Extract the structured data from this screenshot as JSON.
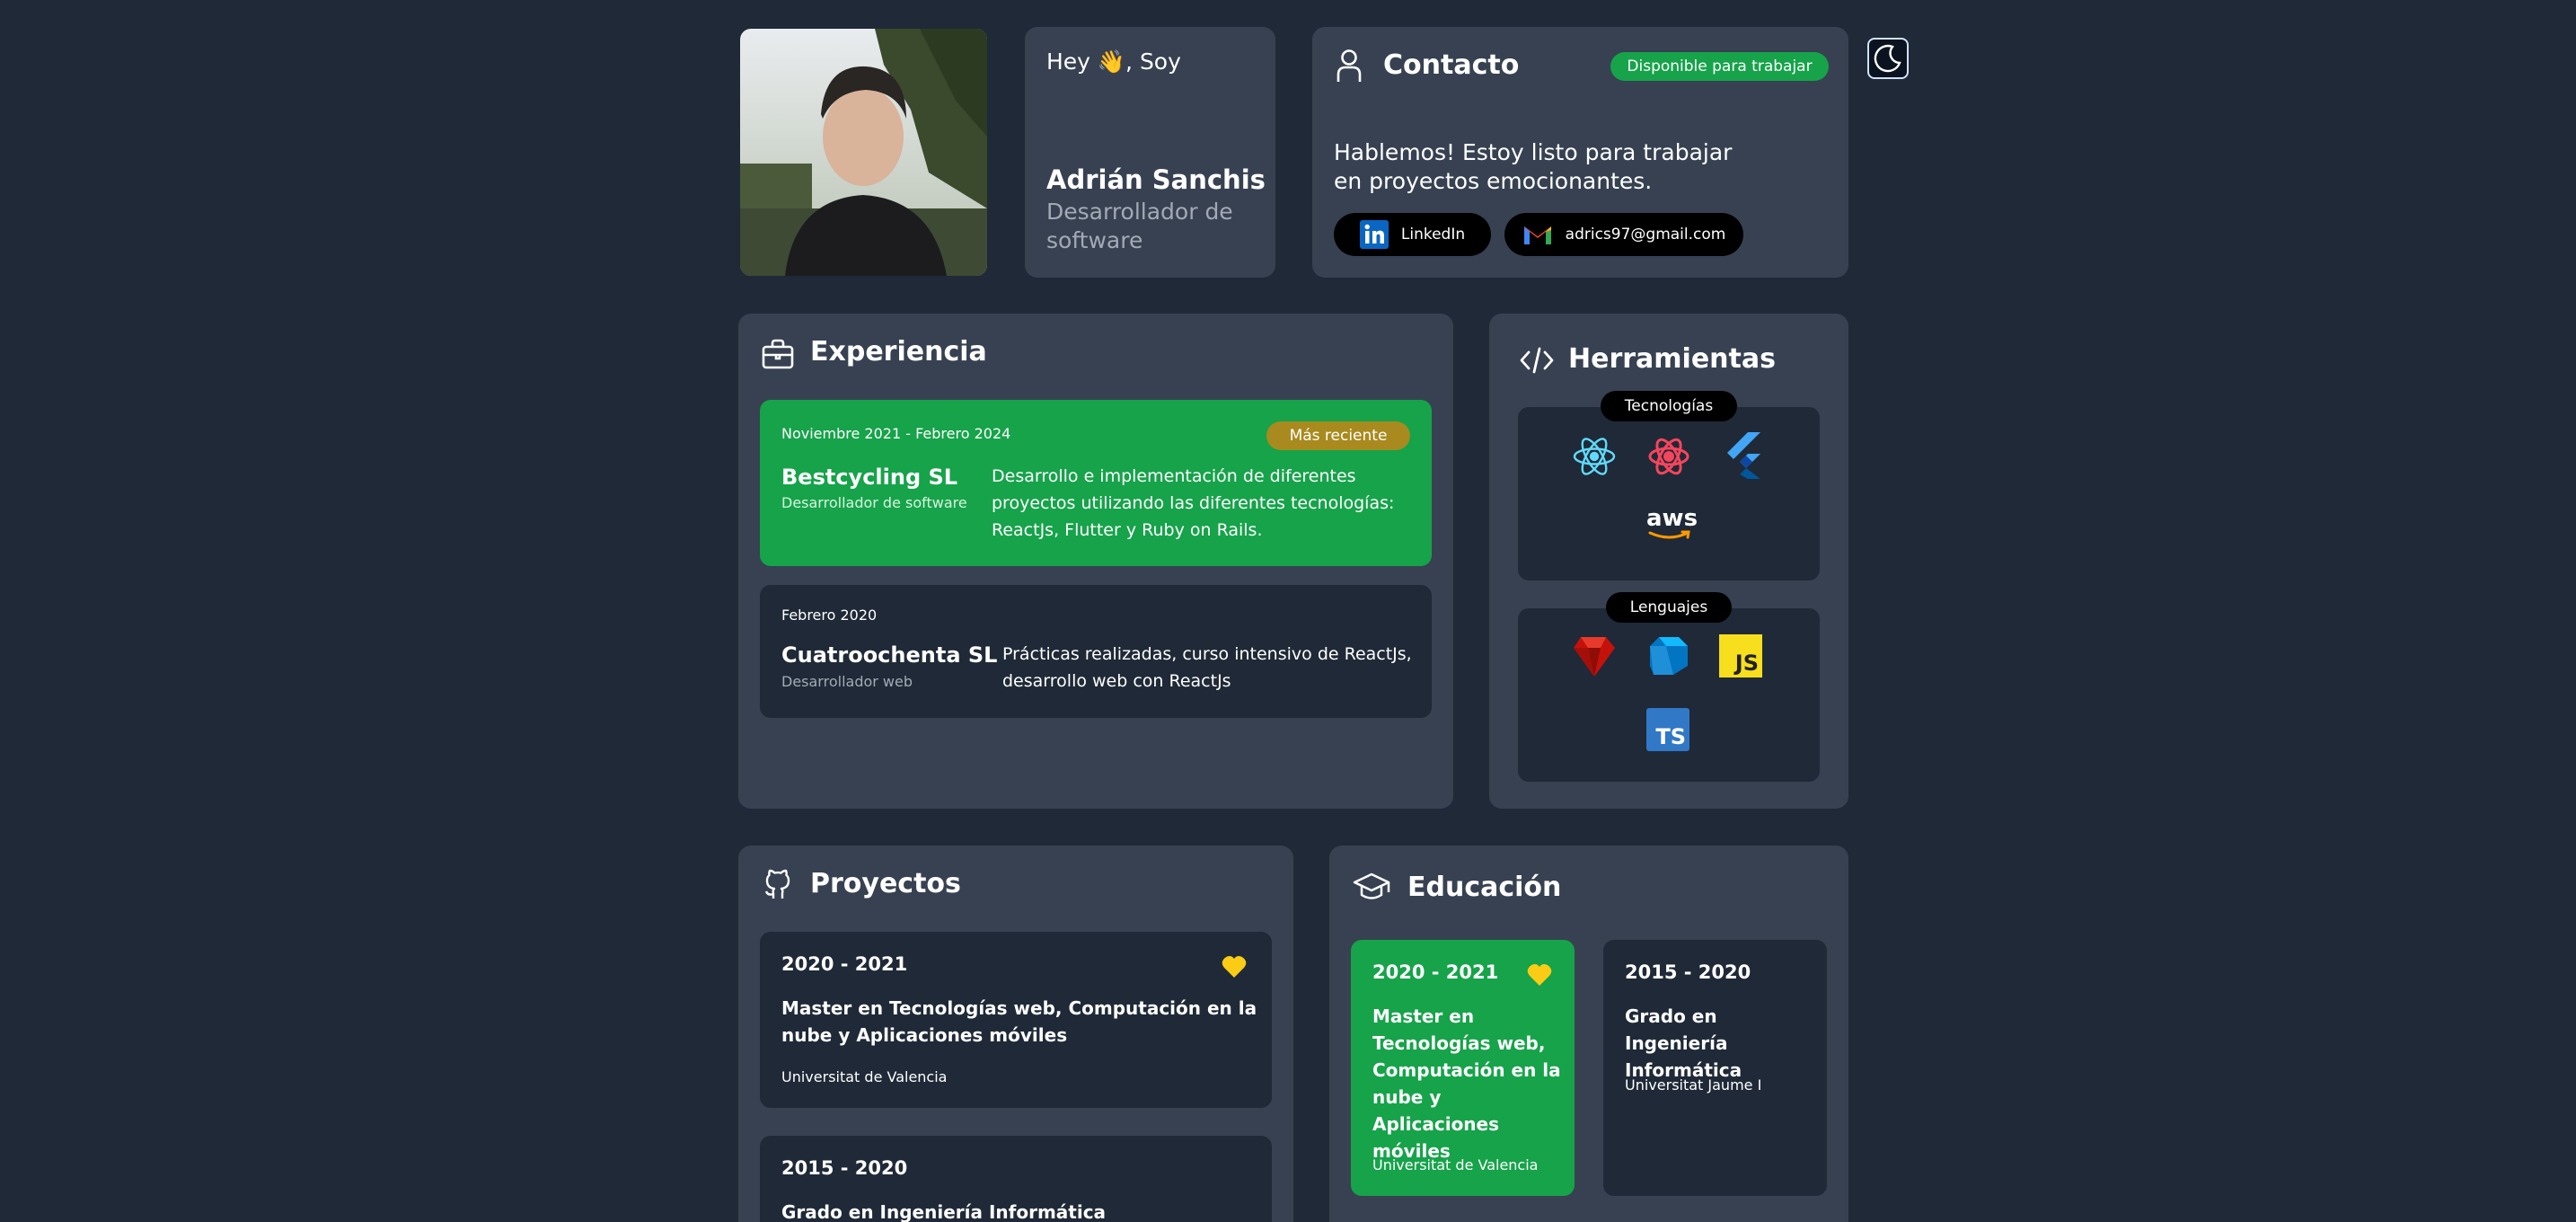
{
  "profile": {
    "photo_alt": "Foto de perfil",
    "greeting": "Hey 👋, Soy",
    "name": "Adrián Sanchis",
    "role": "Desarrollador de software"
  },
  "contact": {
    "title": "Contacto",
    "badge": "Disponible para trabajar",
    "message": "Hablemos! Estoy listo para trabajar en proyectos emocionantes.",
    "linkedin_label": "LinkedIn",
    "email_label": "adrics97@gmail.com"
  },
  "experience": {
    "title": "Experiencia",
    "items": [
      {
        "dates": "Noviembre 2021 - Febrero 2024",
        "badge": "Más reciente",
        "company": "Bestcycling SL",
        "role": "Desarrollador de software",
        "description": "Desarrollo e implementación de diferentes proyectos utilizando las diferentes tecnologías: ReactJs, Flutter y Ruby on Rails."
      },
      {
        "dates": "Febrero 2020",
        "company": "Cuatroochenta SL",
        "role": "Desarrollador web",
        "description": "Prácticas realizadas, curso intensivo de ReactJs, desarrollo web con ReactJs"
      }
    ]
  },
  "tools": {
    "title": "Herramientas",
    "tech_label": "Tecnologías",
    "tech_icons": [
      "react-icon",
      "recoil-icon",
      "flutter-icon",
      "aws-icon"
    ],
    "aws_text": "aws",
    "lang_label": "Lenguajes",
    "lang_icons": [
      "ruby-icon",
      "dart-icon",
      "javascript-icon",
      "typescript-icon"
    ],
    "js_text": "JS",
    "ts_text": "TS"
  },
  "projects": {
    "title": "Proyectos",
    "items": [
      {
        "years": "2020 - 2021",
        "title": "Master en Tecnologías web, Computación en la nube y Aplicaciones móviles",
        "school": "Universitat de Valencia"
      },
      {
        "years": "2015 - 2020",
        "title": "Grado en Ingeniería Informática"
      }
    ]
  },
  "education": {
    "title": "Educación",
    "items": [
      {
        "years": "2020 - 2021",
        "title": "Master en Tecnologías web, Computación en la nube y Aplicaciones móviles",
        "school": "Universitat de Valencia"
      },
      {
        "years": "2015 - 2020",
        "title": "Grado en Ingeniería Informática",
        "school": "Universitat Jaume I"
      }
    ]
  },
  "colors": {
    "background": "#1f2937",
    "card": "#374151",
    "green": "#16a34a",
    "badge_gold": "#a98a1e",
    "heart": "#facc15"
  }
}
